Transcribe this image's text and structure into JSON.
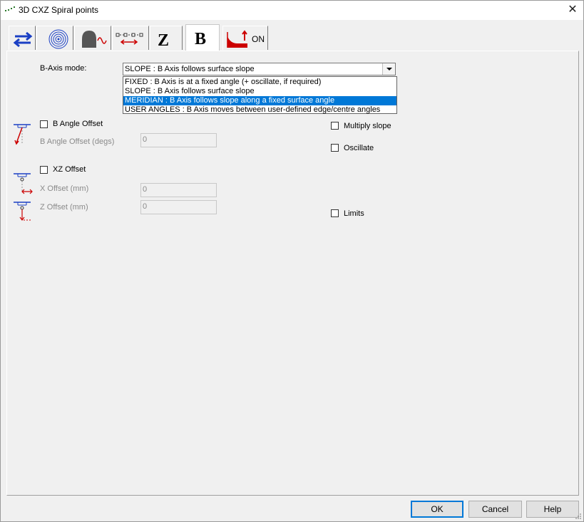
{
  "window": {
    "title": "3D CXZ Spiral points"
  },
  "tabs": [
    {
      "name": "direction",
      "icon": "swap-arrows-icon"
    },
    {
      "name": "spiral",
      "icon": "spiral-icon"
    },
    {
      "name": "tool-profile",
      "icon": "tool-profile-icon"
    },
    {
      "name": "points",
      "icon": "points-icon"
    },
    {
      "name": "z",
      "icon": "z-letter-icon",
      "label": "Z"
    },
    {
      "name": "b",
      "icon": "b-letter-icon",
      "label": "B",
      "active": true
    },
    {
      "name": "limits-on",
      "icon": "limits-icon",
      "label": "ON"
    }
  ],
  "b_axis": {
    "label": "B-Axis mode:",
    "selected": "SLOPE :   B Axis follows surface slope",
    "options": [
      "FIXED :   B Axis is at a fixed angle (+ oscillate, if required)",
      "SLOPE :   B Axis follows surface slope",
      "MERIDIAN :   B Axis follows slope along a fixed surface angle",
      "USER ANGLES :   B Axis moves between user-defined edge/centre angles"
    ],
    "highlighted_index": 2
  },
  "angle_offset": {
    "checkbox_label": "B Angle Offset",
    "checked": false,
    "field_label": "B Angle Offset (degs)",
    "value": "0"
  },
  "xz_offset": {
    "checkbox_label": "XZ Offset",
    "checked": false,
    "x_label": "X Offset (mm)",
    "x_value": "0",
    "z_label": "Z Offset (mm)",
    "z_value": "0"
  },
  "right_options": {
    "multiply_slope": "Multiply slope",
    "oscillate": "Oscillate",
    "limits": "Limits"
  },
  "buttons": {
    "ok": "OK",
    "cancel": "Cancel",
    "help": "Help"
  },
  "colors": {
    "accent": "#0078d7",
    "icon_red": "#cc0000",
    "icon_blue": "#1a3fc4"
  }
}
